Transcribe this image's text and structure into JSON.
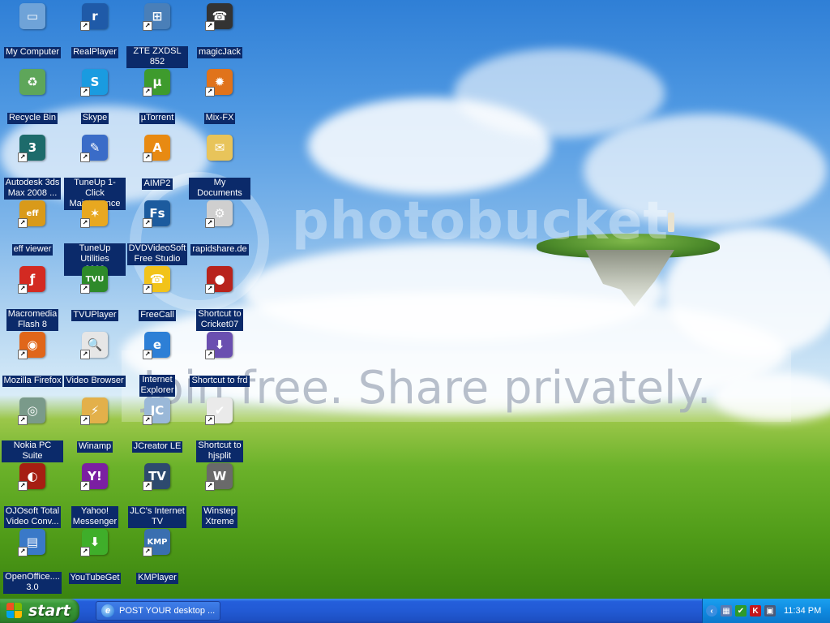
{
  "desktop": {
    "watermark": {
      "logo": "photobucket",
      "tagline": "Join free. Share privately."
    },
    "icons": [
      {
        "label": "My Computer",
        "icon": "my-computer-icon",
        "glyph": "▭",
        "color": "#6fa3d8",
        "shortcut": false
      },
      {
        "label": "RealPlayer",
        "icon": "realplayer-icon",
        "glyph": "r",
        "color": "#1f5aa8",
        "shortcut": true
      },
      {
        "label": "ZTE ZXDSL 852",
        "icon": "network-icon",
        "glyph": "⊞",
        "color": "#4a7fb8",
        "shortcut": true
      },
      {
        "label": "magicJack",
        "icon": "magicjack-icon",
        "glyph": "☎",
        "color": "#333333",
        "shortcut": true
      },
      {
        "label": "Recycle Bin",
        "icon": "recycle-bin-icon",
        "glyph": "♻",
        "color": "#5ea65a",
        "shortcut": false
      },
      {
        "label": "Skype",
        "icon": "skype-icon",
        "glyph": "S",
        "color": "#1a9be0",
        "shortcut": true
      },
      {
        "label": "µTorrent",
        "icon": "utorrent-icon",
        "glyph": "µ",
        "color": "#3e9b2d",
        "shortcut": true
      },
      {
        "label": "Mix-FX",
        "icon": "mix-fx-icon",
        "glyph": "✹",
        "color": "#e0731b",
        "shortcut": true
      },
      {
        "label": "Autodesk 3ds\nMax 2008 ...",
        "icon": "3ds-max-icon",
        "glyph": "3",
        "color": "#1d6b6b",
        "shortcut": true
      },
      {
        "label": "TuneUp 1-Click\nMaintenance",
        "icon": "tuneup-icon",
        "glyph": "✎",
        "color": "#3a6cc8",
        "shortcut": true
      },
      {
        "label": "AIMP2",
        "icon": "aimp2-icon",
        "glyph": "A",
        "color": "#e88a12",
        "shortcut": true
      },
      {
        "label": "My Documents",
        "icon": "my-documents-icon",
        "glyph": "✉",
        "color": "#e8c45a",
        "shortcut": false
      },
      {
        "label": "eff viewer",
        "icon": "eff-viewer-icon",
        "glyph": "eff",
        "color": "#d99a1a",
        "shortcut": true
      },
      {
        "label": "TuneUp Utilities\n2008",
        "icon": "tuneup-utilities-icon",
        "glyph": "✶",
        "color": "#e8a820",
        "shortcut": true
      },
      {
        "label": "DVDVideoSoft\nFree Studio",
        "icon": "dvdvideosoft-icon",
        "glyph": "Fs",
        "color": "#1c5b9e",
        "shortcut": true
      },
      {
        "label": "rapidshare.de",
        "icon": "rapidshare-icon",
        "glyph": "⚙",
        "color": "#cfcfcf",
        "shortcut": true
      },
      {
        "label": "Macromedia\nFlash 8",
        "icon": "flash-icon",
        "glyph": "ƒ",
        "color": "#d32a22",
        "shortcut": true
      },
      {
        "label": "TVUPlayer",
        "icon": "tvuplayer-icon",
        "glyph": "TVU",
        "color": "#2e8a2a",
        "shortcut": true
      },
      {
        "label": "FreeCall",
        "icon": "freecall-icon",
        "glyph": "☎",
        "color": "#f2c31a",
        "shortcut": true
      },
      {
        "label": "Shortcut to\nCricket07",
        "icon": "cricket07-icon",
        "glyph": "●",
        "color": "#b8231c",
        "shortcut": true
      },
      {
        "label": "Mozilla Firefox",
        "icon": "firefox-icon",
        "glyph": "◉",
        "color": "#e0661a",
        "shortcut": true
      },
      {
        "label": "Video Browser",
        "icon": "video-browser-icon",
        "glyph": "🔍",
        "color": "#e6e6e6",
        "shortcut": true
      },
      {
        "label": "Internet\nExplorer",
        "icon": "internet-explorer-icon",
        "glyph": "e",
        "color": "#2d7fd6",
        "shortcut": true
      },
      {
        "label": "Shortcut to frd",
        "icon": "frd-icon",
        "glyph": "⬇",
        "color": "#6a4fb0",
        "shortcut": true
      },
      {
        "label": "Nokia PC Suite",
        "icon": "nokia-pc-suite-icon",
        "glyph": "◎",
        "color": "#7a9a8a",
        "shortcut": true
      },
      {
        "label": "Winamp",
        "icon": "winamp-icon",
        "glyph": "⚡",
        "color": "#e3b04a",
        "shortcut": true
      },
      {
        "label": "JCreator LE",
        "icon": "jcreator-icon",
        "glyph": "JC",
        "color": "#9ab8d8",
        "shortcut": true
      },
      {
        "label": "Shortcut to\nhjsplit",
        "icon": "hjsplit-icon",
        "glyph": "✔",
        "color": "#eaeaea",
        "shortcut": true
      },
      {
        "label": "OJOsoft Total\nVideo Conv...",
        "icon": "ojosoft-icon",
        "glyph": "◐",
        "color": "#a61e12",
        "shortcut": true
      },
      {
        "label": "Yahoo!\nMessenger",
        "icon": "yahoo-messenger-icon",
        "glyph": "Y!",
        "color": "#7b1fa2",
        "shortcut": true
      },
      {
        "label": "JLC's Internet\nTV",
        "icon": "jlc-internet-tv-icon",
        "glyph": "TV",
        "color": "#2d4a6e",
        "shortcut": true
      },
      {
        "label": "Winstep\nXtreme",
        "icon": "winstep-xtreme-icon",
        "glyph": "W",
        "color": "#6a6a6a",
        "shortcut": true
      },
      {
        "label": "OpenOffice....\n3.0",
        "icon": "openoffice-icon",
        "glyph": "▤",
        "color": "#3a79c8",
        "shortcut": true
      },
      {
        "label": "YouTubeGet",
        "icon": "youtubeget-icon",
        "glyph": "⬇",
        "color": "#3fae2a",
        "shortcut": true
      },
      {
        "label": "KMPlayer",
        "icon": "kmplayer-icon",
        "glyph": "KMP",
        "color": "#3a6fb0",
        "shortcut": true
      }
    ]
  },
  "taskbar": {
    "start_label": "start",
    "task_label": "POST YOUR desktop ...",
    "tray_icons": [
      {
        "icon": "tray-arrow-icon",
        "glyph": "‹",
        "color": "#3a8ee0"
      },
      {
        "icon": "tray-network-icon",
        "glyph": "▦",
        "color": "#5a7ab0"
      },
      {
        "icon": "tray-shield-icon",
        "glyph": "✔",
        "color": "#2e9a2a"
      },
      {
        "icon": "tray-kaspersky-icon",
        "glyph": "K",
        "color": "#c4161c"
      },
      {
        "icon": "tray-monitor-icon",
        "glyph": "▣",
        "color": "#4a5a7a"
      }
    ],
    "clock": "11:34 PM"
  }
}
